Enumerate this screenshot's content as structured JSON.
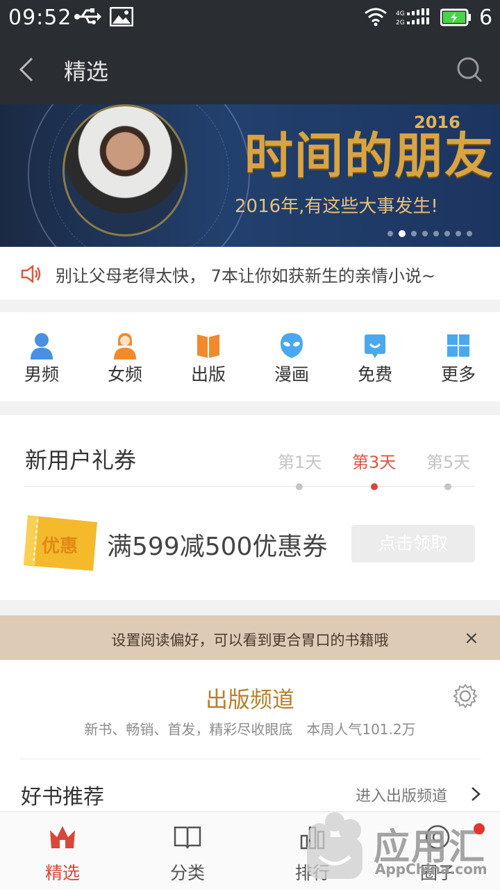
{
  "status_bar": {
    "time": "09:52",
    "battery_level": "6",
    "icons": [
      "usb-icon",
      "image-icon",
      "wifi-icon",
      "signal-icon",
      "battery-icon"
    ]
  },
  "header": {
    "title": "精选",
    "icons": [
      "back-icon",
      "search-icon"
    ]
  },
  "banner": {
    "title": "时间的朋友",
    "year": "2016",
    "subtitle": "2016年,有这些大事发生!",
    "active_slide": 2,
    "slide_count": 8
  },
  "notice": {
    "text": "别让父母老得太快， 7本让你如获新生的亲情小说~",
    "icon": "speaker-icon"
  },
  "categories": [
    {
      "label": "男频",
      "icon": "male-user-icon",
      "color": "#4a8fe0"
    },
    {
      "label": "女频",
      "icon": "female-user-icon",
      "color": "#f08a2c"
    },
    {
      "label": "出版",
      "icon": "book-icon",
      "color": "#f08a2c"
    },
    {
      "label": "漫画",
      "icon": "alien-face-icon",
      "color": "#4aa8f0"
    },
    {
      "label": "免费",
      "icon": "gift-box-icon",
      "color": "#4aa8f0"
    },
    {
      "label": "更多",
      "icon": "grid-icon",
      "color": "#4aa8f0"
    }
  ],
  "coupon": {
    "title": "新用户礼券",
    "days": [
      "第1天",
      "第3天",
      "第5天"
    ],
    "active_day_index": 1,
    "ticket_label": "优惠",
    "description": "满599减500优惠券",
    "button_label": "点击领取"
  },
  "preference": {
    "text": "设置阅读偏好，可以看到更合胃口的书籍哦",
    "close_label": "×"
  },
  "channel": {
    "title": "出版频道",
    "subtitle": "新书、畅销、首发，精彩尽收眼底　本周人气101.2万",
    "section_title": "好书推荐",
    "section_link": "进入出版频道"
  },
  "bottom_nav": [
    {
      "label": "精选",
      "icon": "crown-icon",
      "active": true
    },
    {
      "label": "分类",
      "icon": "open-book-icon",
      "active": false
    },
    {
      "label": "排行",
      "icon": "bar-chart-icon",
      "active": false
    },
    {
      "label": "圈子",
      "icon": "circle-icon",
      "active": false
    }
  ],
  "watermark": {
    "text": "应用汇",
    "domain": "AppChina.com"
  },
  "colors": {
    "bar_dark": "#2a2d31",
    "accent_red": "#d9473a",
    "channel_gold": "#b7802a",
    "preference_bg": "#ddcbb6"
  }
}
